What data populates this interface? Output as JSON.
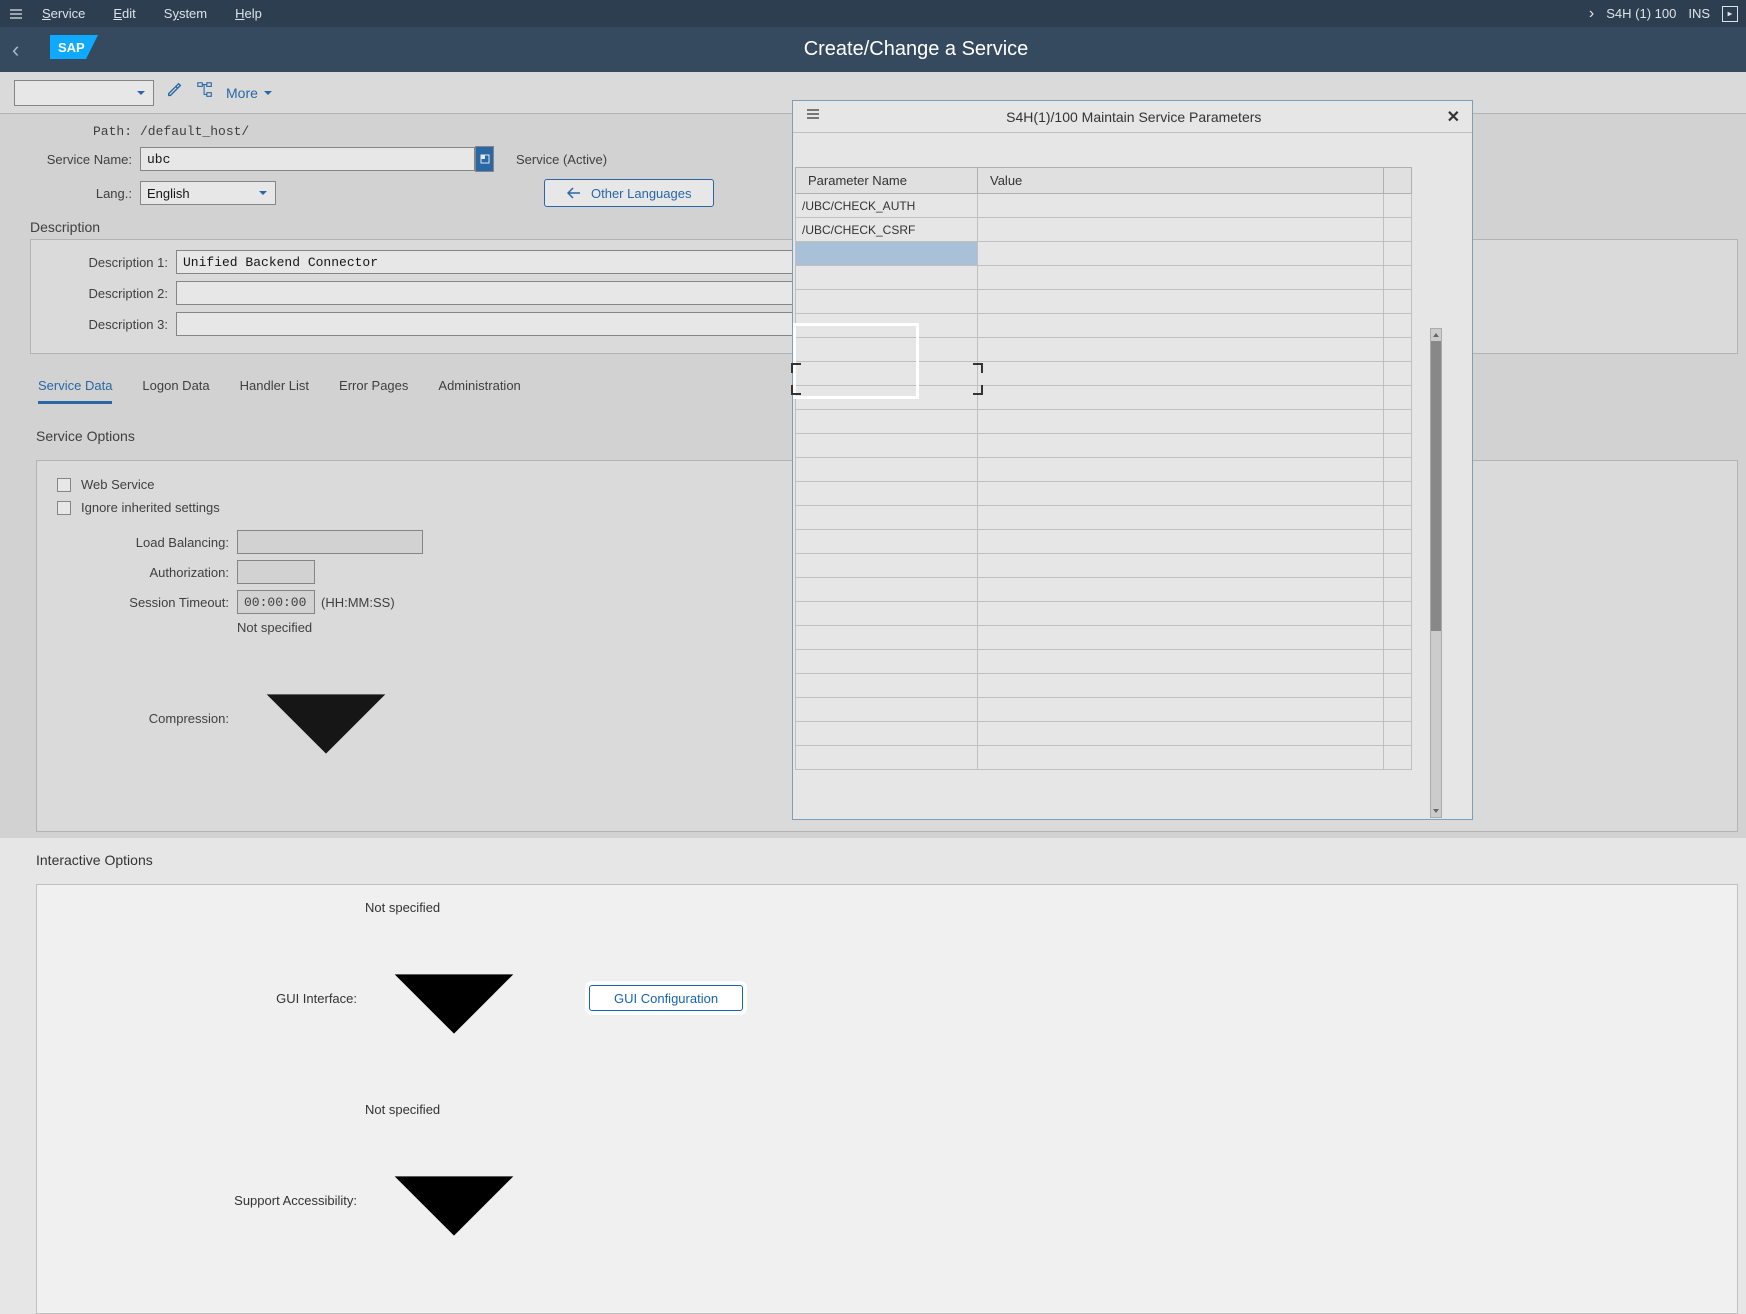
{
  "menubar": {
    "items": [
      "Service",
      "Edit",
      "System",
      "Help"
    ],
    "system": "S4H (1) 100",
    "mode": "INS"
  },
  "title": "Create/Change a Service",
  "toolbar": {
    "more": "More"
  },
  "form": {
    "path_label": "Path:",
    "path_value": "/default_host/",
    "service_name_label": "Service Name:",
    "service_name_value": "ubc",
    "service_status": "Service (Active)",
    "lang_label": "Lang.:",
    "lang_value": "English",
    "other_lang_btn": "Other Languages"
  },
  "description": {
    "title": "Description",
    "d1_label": "Description 1:",
    "d1_value": "Unified Backend Connector",
    "d2_label": "Description 2:",
    "d2_value": "",
    "d3_label": "Description 3:",
    "d3_value": ""
  },
  "tabs": [
    "Service Data",
    "Logon Data",
    "Handler List",
    "Error Pages",
    "Administration"
  ],
  "service_options": {
    "title": "Service Options",
    "web_service": "Web Service",
    "ignore_inherited": "Ignore inherited settings",
    "load_balancing_label": "Load Balancing:",
    "authorization_label": "Authorization:",
    "session_timeout_label": "Session Timeout:",
    "session_timeout_value": "00:00:00",
    "session_timeout_suffix": "(HH:MM:SS)",
    "compression_label": "Compression:",
    "compression_value": "Not specified"
  },
  "interactive_options": {
    "title": "Interactive Options",
    "gui_interface_label": "GUI Interface:",
    "gui_interface_value": "Not specified",
    "gui_config_btn": "GUI Configuration",
    "support_access_label": "Support Accessibility:",
    "support_access_value": "Not specified"
  },
  "panel": {
    "title": "S4H(1)/100 Maintain Service Parameters",
    "col_param": "Parameter Name",
    "col_value": "Value",
    "rows": [
      {
        "param": "/UBC/CHECK_AUTH",
        "value": ""
      },
      {
        "param": "/UBC/CHECK_CSRF",
        "value": ""
      }
    ]
  }
}
